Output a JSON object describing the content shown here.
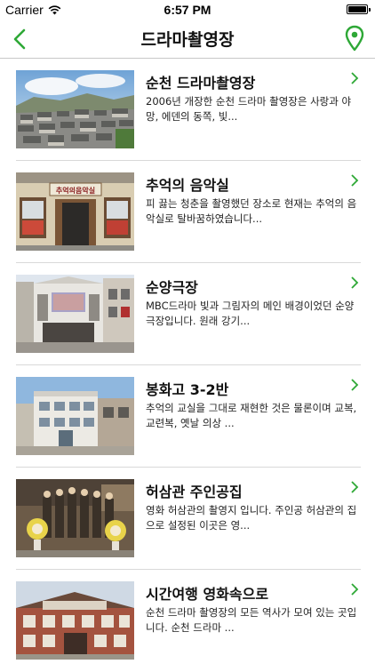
{
  "status": {
    "carrier": "Carrier",
    "time": "6:57 PM"
  },
  "nav": {
    "title": "드라마촬영장",
    "accent": "#2ea836"
  },
  "items": [
    {
      "title": "순천 드라마촬영장",
      "desc": "2006년 개장한 순천 드라마 촬영장은 사랑과 야망, 에덴의 동쪽, 빛..."
    },
    {
      "title": "추억의 음악실",
      "desc": "피 끓는 청춘을 촬영했던 장소로 현재는 추억의 음악실로 탈바꿈하였습니다...",
      "sign": "추억의음악실"
    },
    {
      "title": "순양극장",
      "desc": "MBC드라마 빛과 그림자의 메인 배경이었던 순양극장입니다. 원래 강기..."
    },
    {
      "title": "봉화고 3-2반",
      "desc": "추억의 교실을 그대로 재현한 것은 물론이며 교복, 교련복, 옛날 의상 ..."
    },
    {
      "title": "허삼관 주인공집",
      "desc": "영화 허삼관의 촬영지 입니다. 주인공 허삼관의 집으로 설정된 이곳은 영..."
    },
    {
      "title": "시간여행 영화속으로",
      "desc": "순천 드라마 촬영장의 모든 역사가 모여 있는 곳입니다. 순천 드라마 ..."
    }
  ]
}
